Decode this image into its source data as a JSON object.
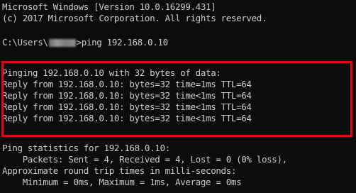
{
  "console": {
    "header_line1": "Microsoft Windows [Version 10.0.16299.431]",
    "header_line2": "(c) 2017 Microsoft Corporation. All rights reserved.",
    "prompt_prefix": "C:\\Users\\",
    "prompt_suffix": ">ping 192.168.0.10",
    "highlighted_output": [
      "Pinging 192.168.0.10 with 32 bytes of data:",
      "Reply from 192.168.0.10: bytes=32 time=1ms TTL=64",
      "Reply from 192.168.0.10: bytes=32 time<1ms TTL=64",
      "Reply from 192.168.0.10: bytes=32 time<1ms TTL=64",
      "Reply from 192.168.0.10: bytes=32 time<1ms TTL=64"
    ],
    "statistics": [
      "Ping statistics for 192.168.0.10:",
      "    Packets: Sent = 4, Received = 4, Lost = 0 (0% loss),",
      "Approximate round trip times in milli-seconds:",
      "    Minimum = 0ms, Maximum = 1ms, Average = 0ms"
    ]
  },
  "colors": {
    "background": "#0c0c0c",
    "text": "#cccccc",
    "highlight_border": "#e30613"
  }
}
